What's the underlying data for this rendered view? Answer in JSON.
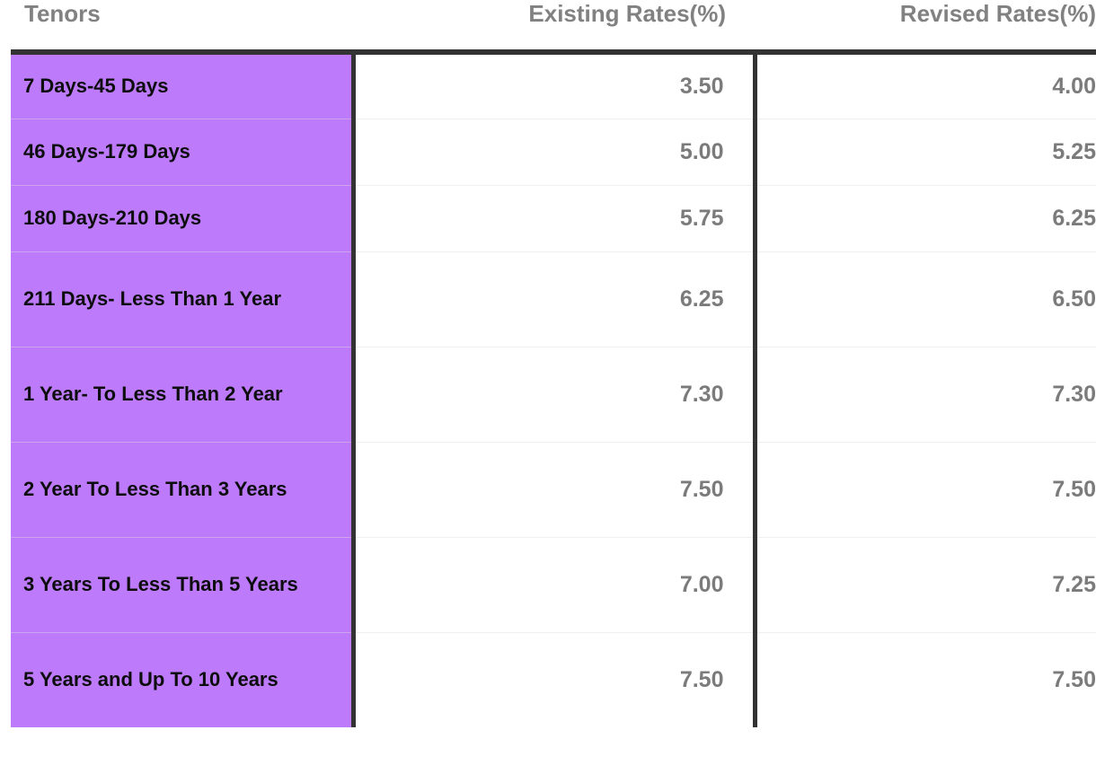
{
  "table": {
    "columns": [
      {
        "key": "tenor",
        "label": "Tenors",
        "align": "left"
      },
      {
        "key": "existing",
        "label": "Existing Rates(%)",
        "align": "right"
      },
      {
        "key": "revised",
        "label": "Revised Rates(%)",
        "align": "right"
      }
    ],
    "rows": [
      {
        "tenor": "7 Days-45 Days",
        "existing": "3.50",
        "revised": "4.00"
      },
      {
        "tenor": "46 Days-179 Days",
        "existing": "5.00",
        "revised": "5.25"
      },
      {
        "tenor": "180 Days-210 Days",
        "existing": "5.75",
        "revised": "6.25"
      },
      {
        "tenor": "211 Days- Less Than 1 Year",
        "existing": "6.25",
        "revised": "6.50"
      },
      {
        "tenor": "1 Year- To Less Than 2 Year",
        "existing": "7.30",
        "revised": "7.30"
      },
      {
        "tenor": "2 Year To Less Than 3 Years",
        "existing": "7.50",
        "revised": "7.50"
      },
      {
        "tenor": "3 Years To Less Than 5 Years",
        "existing": "7.00",
        "revised": "7.25"
      },
      {
        "tenor": "5 Years and Up To 10 Years",
        "existing": "7.50",
        "revised": "7.50"
      }
    ]
  },
  "colors": {
    "tenor_cell_background": "#bd7bfb",
    "header_text": "#818181",
    "value_text": "#7b7b7b",
    "tenor_text": "#0d0d0d",
    "heavy_rule": "#333333",
    "light_rule": "#efefef",
    "page_background": "#ffffff"
  }
}
